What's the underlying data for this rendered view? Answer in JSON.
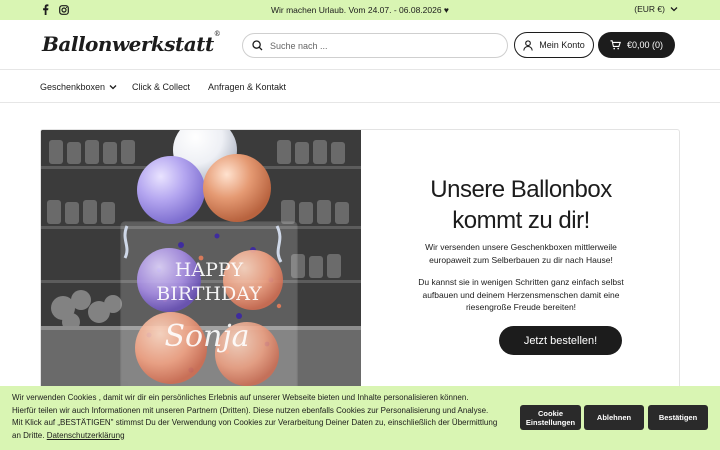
{
  "topbar": {
    "social": [
      {
        "name": "facebook-icon",
        "glyph": "f"
      },
      {
        "name": "instagram-icon",
        "glyph": ""
      }
    ],
    "announcement": "Wir machen Urlaub. Vom 24.07. - 06.08.2026 ♥",
    "currency": "(EUR €)"
  },
  "header": {
    "logo": "Ballonwerkstatt",
    "logo_mark": "®",
    "search_placeholder": "Suche nach ...",
    "account_label": "Mein Konto",
    "cart_label": "€0,00 (0)"
  },
  "nav": {
    "items": [
      {
        "label": "Geschenkboxen",
        "has_dropdown": true
      },
      {
        "label": "Click & Collect",
        "has_dropdown": false
      },
      {
        "label": "Anfragen & Kontakt",
        "has_dropdown": false
      }
    ]
  },
  "hero": {
    "title_line1": "Unsere Ballonbox",
    "title_line2": "kommt zu dir!",
    "paragraph1": "Wir versenden unsere Geschenkboxen mittlerweile europaweit zum Selberbauen zu dir nach Hause!",
    "paragraph2": "Du kannst sie in wenigen Schritten ganz einfach selbst aufbauen und deinem Herzensmenschen damit eine riesengroße Freude bereiten!",
    "cta_label": "Jetzt bestellen!",
    "image_text_line1": "HAPPY",
    "image_text_line2": "BIRTHDAY",
    "image_text_line3": "Sonja"
  },
  "cookie": {
    "text_line1": "Wir verwenden Cookies    , damit wir dir ein persönliches Erlebnis auf unserer Webseite bieten und Inhalte personalisieren können.",
    "text_line2": "Hierfür teilen wir auch Informationen mit unseren Partnern (Dritten). Diese nutzen ebenfalls Cookies zur Personalisierung und Analyse.",
    "text_line3": "Mit Klick auf „BESTÄTIGEN\" stimmst Du der Verwendung von Cookies zur Verarbeitung Deiner Daten zu, einschließlich der Übermittlung",
    "text_line4": "an Dritte.",
    "privacy_link": "Datenschutzerklärung",
    "settings_line1": "Cookie",
    "settings_line2": "Einstellungen",
    "decline_label": "Ablehnen",
    "accept_label": "Bestätigen"
  },
  "colors": {
    "accent_green": "#d9f5b3",
    "dark": "#1c1c1c"
  }
}
